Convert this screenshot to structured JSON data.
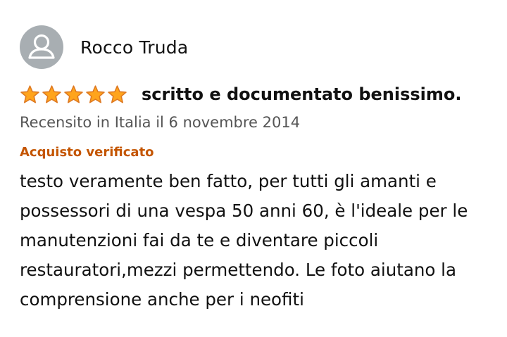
{
  "review": {
    "author_name": "Rocco Truda",
    "avatar_icon": "user-silhouette-icon",
    "rating": 5,
    "rating_max": 5,
    "star_color": "#ffa41c",
    "title": "scritto e documentato benissimo.",
    "date_text": "Recensito in Italia il 6 novembre 2014",
    "verified_label": "Acquisto verificato",
    "verified_color": "#c45500",
    "body_text": "testo veramente ben fatto, per tutti gli amanti e possessori di una vespa 50 anni 60, è l'ideale per le manutenzioni fai da te e diventare piccoli restauratori,mezzi permettendo. Le foto aiutano la comprensione anche per i neofiti"
  }
}
